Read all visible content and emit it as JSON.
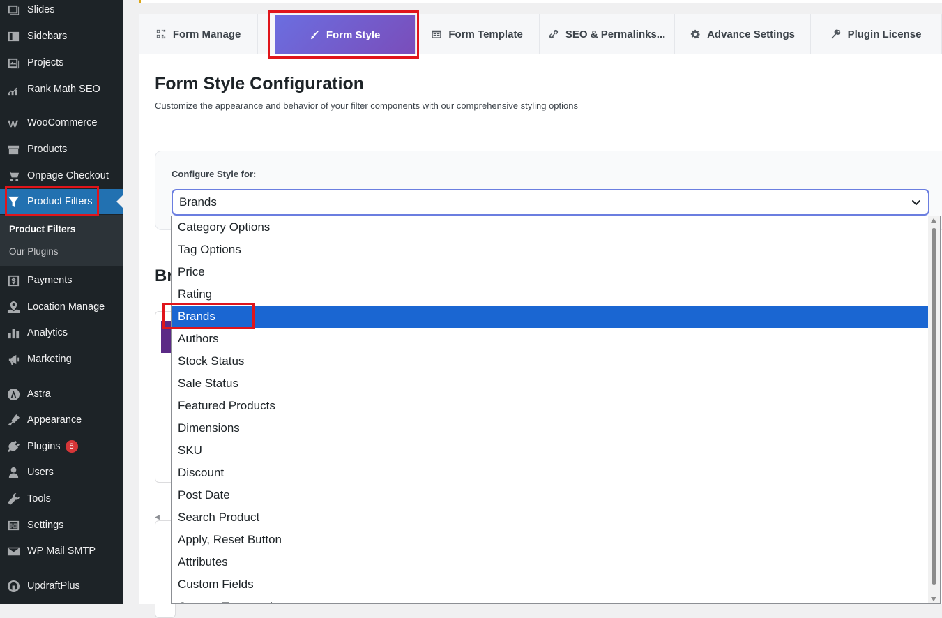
{
  "sidebar": {
    "items": [
      {
        "label": "Slides",
        "icon": "slides-icon"
      },
      {
        "label": "Sidebars",
        "icon": "sidebars-icon"
      },
      {
        "label": "Projects",
        "icon": "projects-icon"
      },
      {
        "label": "Rank Math SEO",
        "icon": "rank-math-icon"
      },
      {
        "label": "WooCommerce",
        "icon": "woocommerce-icon"
      },
      {
        "label": "Products",
        "icon": "products-icon"
      },
      {
        "label": "Onpage Checkout",
        "icon": "cart-icon"
      },
      {
        "label": "Product Filters",
        "icon": "filter-icon"
      },
      {
        "label": "Payments",
        "icon": "payments-icon"
      },
      {
        "label": "Location Manage",
        "icon": "location-icon"
      },
      {
        "label": "Analytics",
        "icon": "analytics-icon"
      },
      {
        "label": "Marketing",
        "icon": "marketing-icon"
      },
      {
        "label": "Astra",
        "icon": "astra-icon"
      },
      {
        "label": "Appearance",
        "icon": "appearance-icon"
      },
      {
        "label": "Plugins",
        "icon": "plugins-icon",
        "badge": "8"
      },
      {
        "label": "Users",
        "icon": "users-icon"
      },
      {
        "label": "Tools",
        "icon": "tools-icon"
      },
      {
        "label": "Settings",
        "icon": "settings-icon"
      },
      {
        "label": "WP Mail SMTP",
        "icon": "mail-icon"
      },
      {
        "label": "UpdraftPlus",
        "icon": "updraft-icon"
      }
    ],
    "submenu": [
      "Product Filters",
      "Our Plugins"
    ]
  },
  "tabs": [
    {
      "label": "Form Manage",
      "icon": "form-manage-icon"
    },
    {
      "label": "Form Style",
      "icon": "brush-icon"
    },
    {
      "label": "Form Template",
      "icon": "template-icon"
    },
    {
      "label": "SEO & Permalinks...",
      "icon": "link-icon"
    },
    {
      "label": "Advance Settings",
      "icon": "gear-icon"
    },
    {
      "label": "Plugin License",
      "icon": "key-icon"
    }
  ],
  "main": {
    "title": "Form Style Configuration",
    "subtitle": "Customize the appearance and behavior of your filter components with our comprehensive styling options",
    "config_label": "Configure Style for:",
    "selected_value": "Brands",
    "section_heading_partial": "Br"
  },
  "dropdown": {
    "options": [
      "Category Options",
      "Tag Options",
      "Price",
      "Rating",
      "Brands",
      "Authors",
      "Stock Status",
      "Sale Status",
      "Featured Products",
      "Dimensions",
      "SKU",
      "Discount",
      "Post Date",
      "Search Product",
      "Apply, Reset Button",
      "Attributes",
      "Custom Fields",
      "Custom Taxonomies"
    ],
    "selected_index": 4
  },
  "colors": {
    "sidebar_bg": "#1d2327",
    "accent": "#2271b1",
    "tab_gradient_start": "#6b6ee0",
    "tab_gradient_end": "#7a4dba",
    "option_selected": "#1a66d2",
    "highlight": "#e0151b"
  }
}
